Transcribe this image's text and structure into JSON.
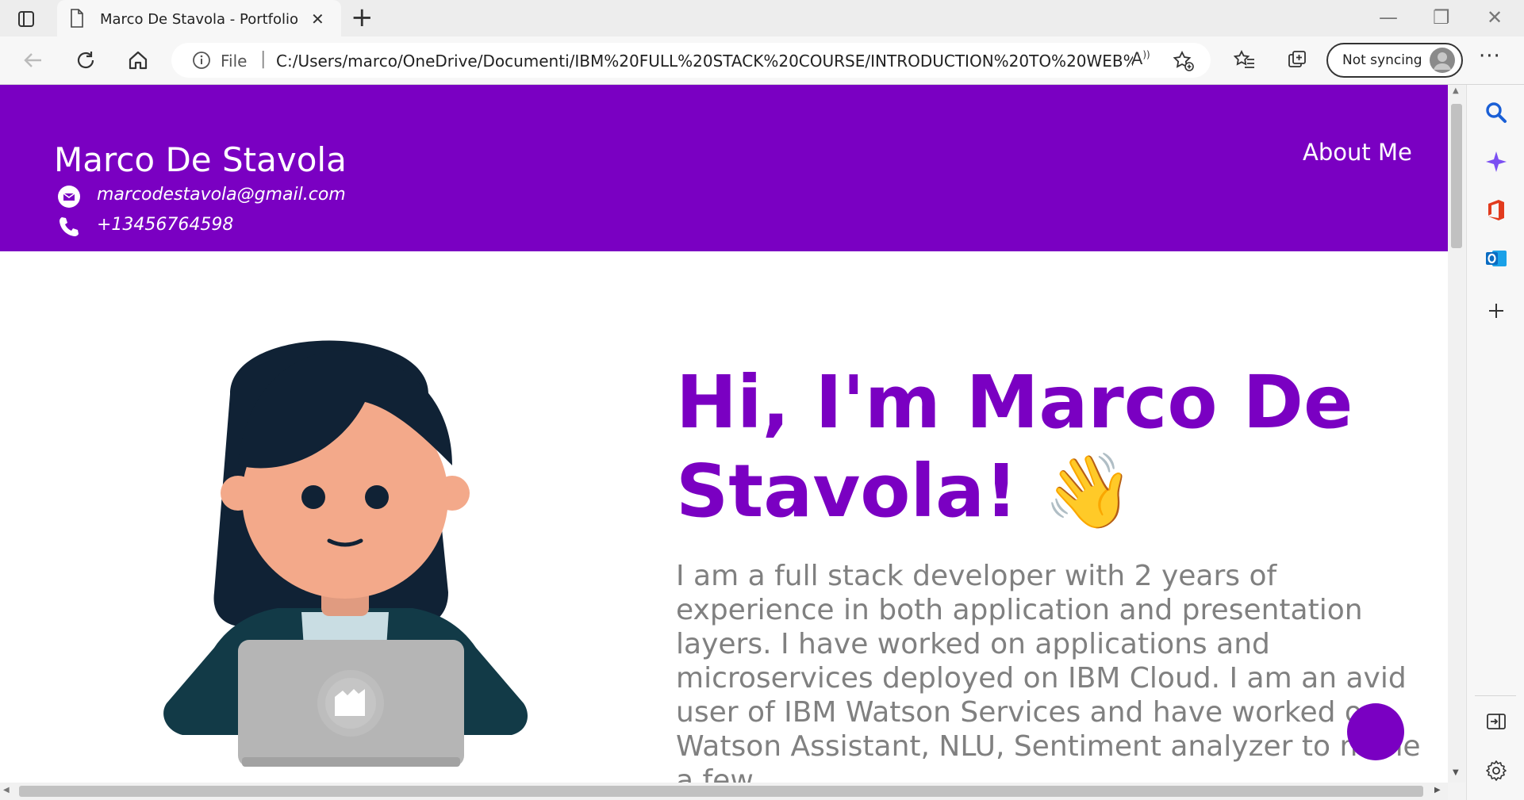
{
  "browser": {
    "tab_title": "Marco De Stavola - Portfolio",
    "address_scheme": "File",
    "address_url": "C:/Users/marco/OneDrive/Documenti/IBM%20FULL%20STACK%20COURSE/INTRODUCTION%20TO%20WEB%20...",
    "sync_label": "Not syncing"
  },
  "site": {
    "name": "Marco De Stavola",
    "email": "marcodestavola@gmail.com",
    "phone": "+13456764598",
    "nav": {
      "about": "About Me"
    },
    "hero": {
      "title": "Hi, I'm Marco De Stavola! 👋",
      "description": "I am a full stack developer with 2 years of experience in both application and presentation layers. I have worked on applications and microservices deployed on IBM Cloud. I am an avid user of IBM Watson Services and have worked on Watson Assistant, NLU, Sentiment analyzer to name a few."
    }
  },
  "colors": {
    "brand": "#7a00c2",
    "description_text": "#808080"
  },
  "icons": {
    "sidebar": [
      "search-icon",
      "copilot-icon",
      "office-icon",
      "outlook-icon",
      "add-icon",
      "sidebar-toggle-icon",
      "settings-icon"
    ]
  }
}
